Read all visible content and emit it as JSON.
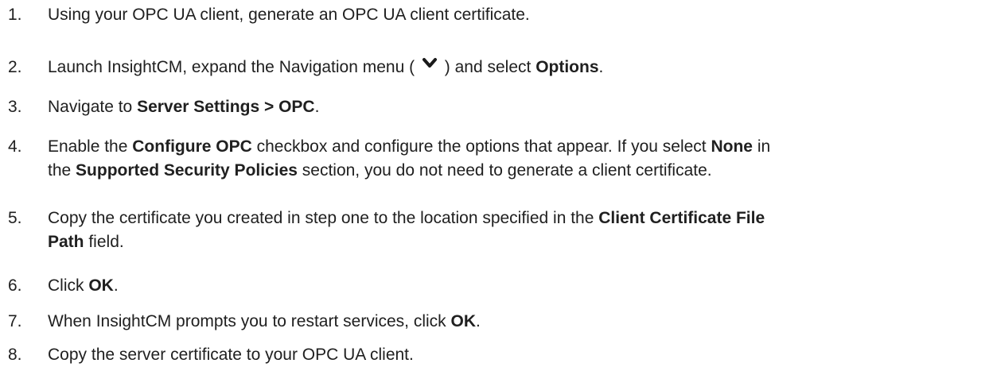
{
  "steps": [
    {
      "number": "1.",
      "lines": [
        [
          {
            "t": "Using your OPC UA client, generate an OPC UA client certificate."
          }
        ]
      ]
    },
    {
      "number": "2.",
      "lines": [
        [
          {
            "t": "Launch InsightCM, expand the Navigation menu ( "
          },
          {
            "icon": "chevron-down-icon"
          },
          {
            "t": " ) and select "
          },
          {
            "t": "Options",
            "b": true
          },
          {
            "t": "."
          }
        ]
      ]
    },
    {
      "number": "3.",
      "lines": [
        [
          {
            "t": "Navigate to "
          },
          {
            "t": "Server Settings > OPC",
            "b": true
          },
          {
            "t": "."
          }
        ]
      ]
    },
    {
      "number": "4.",
      "lines": [
        [
          {
            "t": "Enable the "
          },
          {
            "t": "Configure OPC",
            "b": true
          },
          {
            "t": " checkbox and configure the options that appear. If you select "
          },
          {
            "t": "None",
            "b": true
          },
          {
            "t": " in"
          }
        ],
        [
          {
            "t": "the "
          },
          {
            "t": "Supported Security Policies",
            "b": true
          },
          {
            "t": " section, you do not need to generate a client certificate."
          }
        ]
      ]
    },
    {
      "number": "5.",
      "lines": [
        [
          {
            "t": "Copy the certificate you created in step one to the location specified in the "
          },
          {
            "t": "Client Certificate File",
            "b": true
          }
        ],
        [
          {
            "t": "Path",
            "b": true
          },
          {
            "t": " field."
          }
        ]
      ]
    },
    {
      "number": "6.",
      "lines": [
        [
          {
            "t": "Click "
          },
          {
            "t": "OK",
            "b": true
          },
          {
            "t": "."
          }
        ]
      ]
    },
    {
      "number": "7.",
      "lines": [
        [
          {
            "t": "When InsightCM prompts you to restart services, click "
          },
          {
            "t": "OK",
            "b": true
          },
          {
            "t": "."
          }
        ]
      ]
    },
    {
      "number": "8.",
      "lines": [
        [
          {
            "t": "Copy the server certificate to your OPC UA client."
          }
        ]
      ]
    }
  ]
}
